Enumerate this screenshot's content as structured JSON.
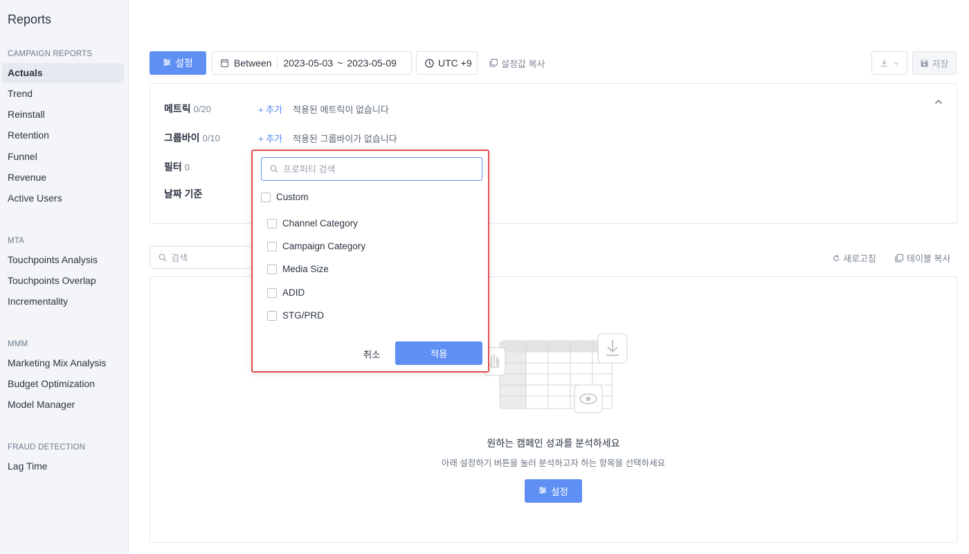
{
  "app": {
    "title": "Reports"
  },
  "sidebar": {
    "sections": [
      {
        "title": "CAMPAIGN REPORTS",
        "items": [
          "Actuals",
          "Trend",
          "Reinstall",
          "Retention",
          "Funnel",
          "Revenue",
          "Active Users"
        ]
      },
      {
        "title": "MTA",
        "items": [
          "Touchpoints Analysis",
          "Touchpoints Overlap",
          "Incrementality"
        ]
      },
      {
        "title": "MMM",
        "items": [
          "Marketing Mix Analysis",
          "Budget Optimization",
          "Model Manager"
        ]
      },
      {
        "title": "FRAUD DETECTION",
        "items": [
          "Lag Time"
        ]
      }
    ],
    "active_item": "Actuals"
  },
  "toolbar": {
    "settings_label": "설정",
    "date_mode": "Between",
    "date_start": "2023-05-03",
    "date_sep": "~",
    "date_end": "2023-05-09",
    "timezone": "UTC +9",
    "copy_settings_label": "설정값 복사",
    "save_label": "저장"
  },
  "panel": {
    "metric": {
      "label": "메트릭",
      "count": "0/20",
      "add_label": "+ 추가",
      "empty": "적용된 메트릭이 없습니다"
    },
    "groupby": {
      "label": "그룹바이",
      "count": "0/10",
      "add_label": "+ 추가",
      "empty": "적용된 그룹바이가 없습니다"
    },
    "filter": {
      "label": "필터",
      "count": "0"
    },
    "date_basis": {
      "label": "날짜 기준"
    }
  },
  "table_actions": {
    "search_placeholder": "검색",
    "refresh_label": "새로고침",
    "copy_table_label": "테이블 복사"
  },
  "empty_state": {
    "title": "원하는 캠페인 성과를 분석하세요",
    "subtitle": "아래 설정하기 버튼을 눌러 분석하고자 하는 항목을 선택하세요",
    "button_label": "설정"
  },
  "dropdown": {
    "search_placeholder": "프로퍼티 검색",
    "group_label": "Custom",
    "options": [
      "Channel Category",
      "Campaign Category",
      "Media Size",
      "ADID",
      "STG/PRD"
    ],
    "cancel_label": "취소",
    "apply_label": "적용"
  },
  "colors": {
    "primary": "#5f8ff3",
    "highlight_border": "#e5484d",
    "sidebar_bg": "#f3f5f8"
  }
}
